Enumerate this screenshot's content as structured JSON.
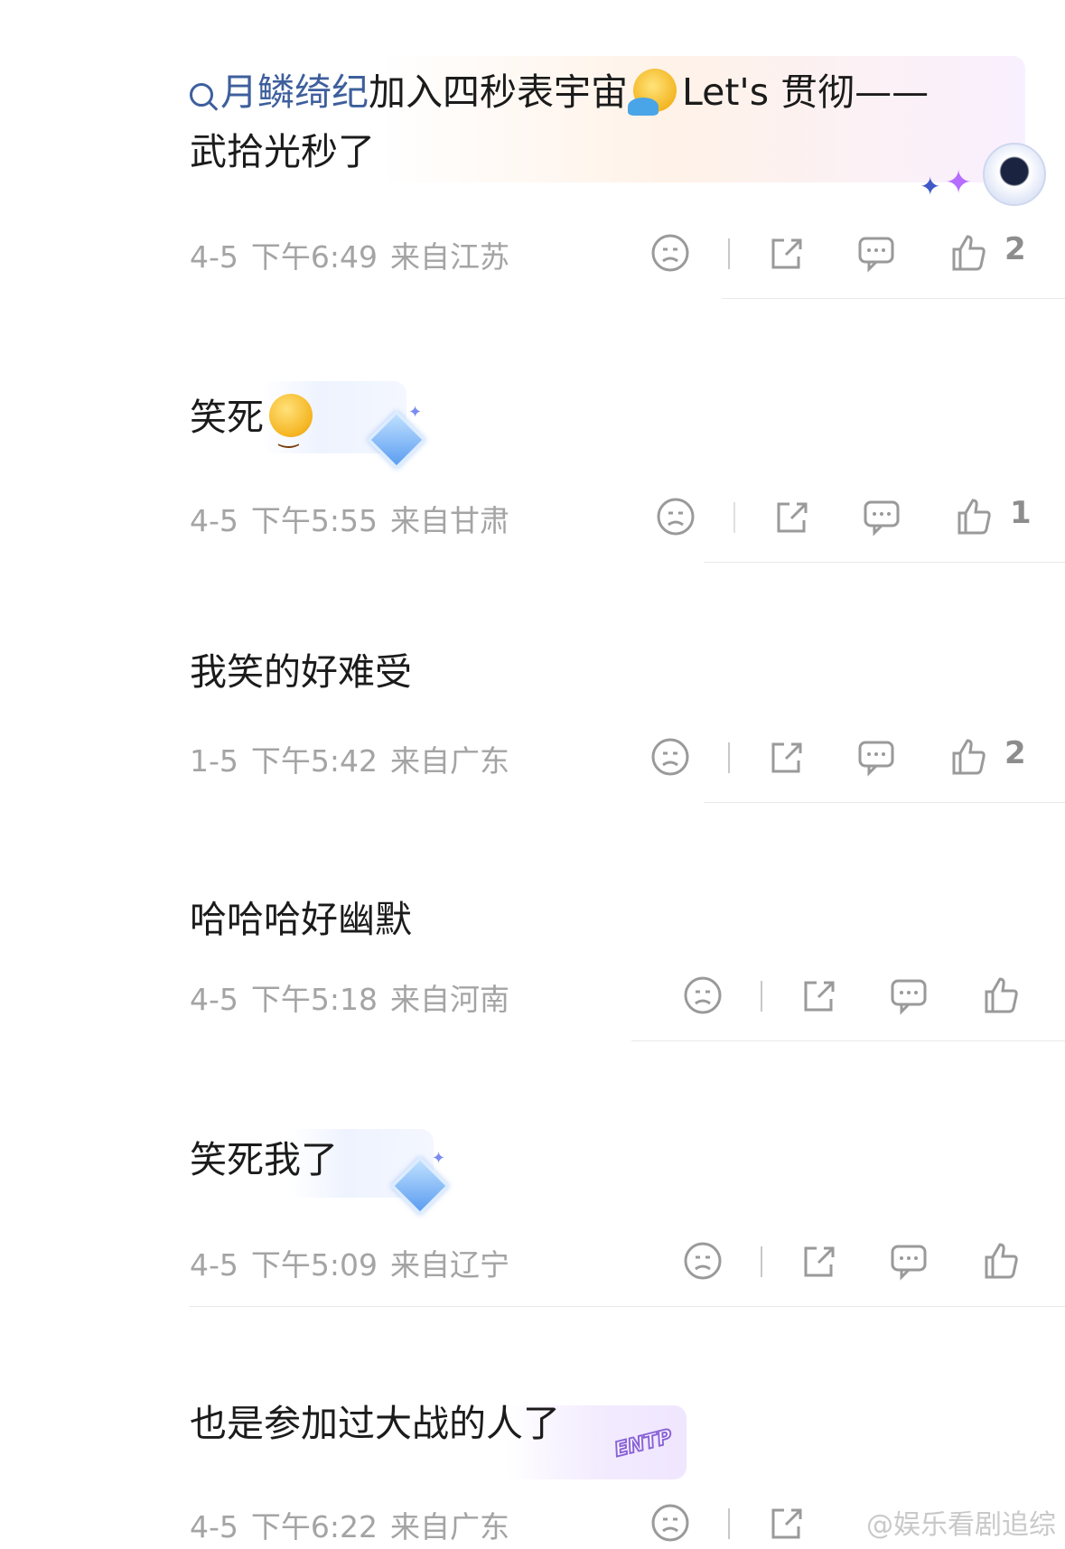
{
  "comments": [
    {
      "text_parts": {
        "link": "月鳞绮纪",
        "mid": "加入四秒表宇宙",
        "tail": "Let's 贯彻——"
      },
      "text_line2": "武拾光秒了",
      "date": "4-5",
      "time": "下午6:49",
      "location": "来自江苏",
      "likes": "2"
    },
    {
      "text": "笑死",
      "date": "4-5",
      "time": "下午5:55",
      "location": "来自甘肃",
      "likes": "1"
    },
    {
      "text": "我笑的好难受",
      "date": "1-5",
      "time": "下午5:42",
      "location": "来自广东",
      "likes": "2"
    },
    {
      "text": "哈哈哈好幽默",
      "date": "4-5",
      "time": "下午5:18",
      "location": "来自河南",
      "likes": ""
    },
    {
      "text": "笑死我了",
      "date": "4-5",
      "time": "下午5:09",
      "location": "来自辽宁",
      "likes": ""
    },
    {
      "text": "也是参加过大战的人了",
      "date": "4-5",
      "time": "下午6:22",
      "location": "来自广东",
      "likes": ""
    }
  ],
  "badges": {
    "entp": "ENTP"
  },
  "watermark": "@娱乐看剧追综",
  "icons": {
    "dislike": "sad-face-icon",
    "share": "share-icon",
    "reply": "comment-bubble-icon",
    "like": "thumbs-up-icon",
    "search": "search-icon"
  },
  "colors": {
    "link": "#3e5f9d",
    "meta": "#a4a4a4",
    "icon": "#9a9a9a"
  }
}
